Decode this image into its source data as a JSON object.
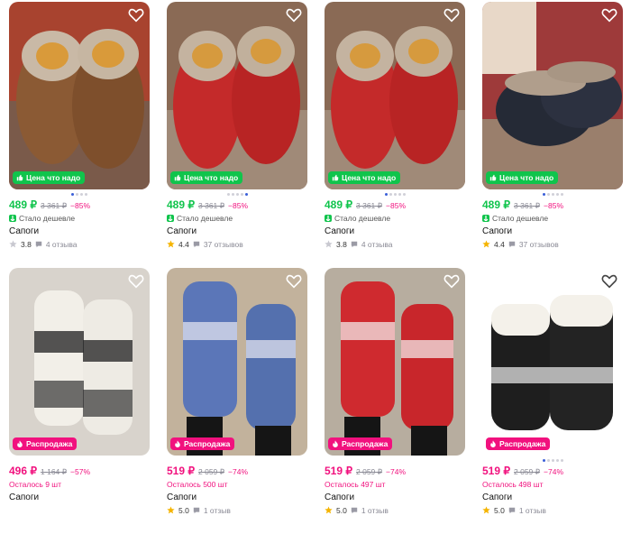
{
  "products": [
    {
      "price": "489 ₽",
      "old_price": "3 361 ₽",
      "discount": "−85%",
      "badge": "Цена что надо",
      "sub": "Стало дешевле",
      "title": "Сапоги",
      "rating": "3.8",
      "reviews": "4 отзыва",
      "rating_star": "gray",
      "color": "brown"
    },
    {
      "price": "489 ₽",
      "old_price": "3 361 ₽",
      "discount": "−85%",
      "badge": "Цена что надо",
      "sub": "Стало дешевле",
      "title": "Сапоги",
      "rating": "4.4",
      "reviews": "37 отзывов",
      "rating_star": "gold",
      "color": "red"
    },
    {
      "price": "489 ₽",
      "old_price": "3 361 ₽",
      "discount": "−85%",
      "badge": "Цена что надо",
      "sub": "Стало дешевле",
      "title": "Сапоги",
      "rating": "3.8",
      "reviews": "4 отзыва",
      "rating_star": "gray",
      "color": "red"
    },
    {
      "price": "489 ₽",
      "old_price": "3 361 ₽",
      "discount": "−85%",
      "badge": "Цена что надо",
      "sub": "Стало дешевле",
      "title": "Сапоги",
      "rating": "4.4",
      "reviews": "37 отзывов",
      "rating_star": "gold",
      "color": "black"
    },
    {
      "price": "496 ₽",
      "old_price": "1 164 ₽",
      "discount": "−57%",
      "badge": "Распродажа",
      "sub": "Осталось 9 шт",
      "title": "Сапоги",
      "rating": "",
      "reviews": "",
      "rating_star": "none",
      "color": "bw"
    },
    {
      "price": "519 ₽",
      "old_price": "2 059 ₽",
      "discount": "−74%",
      "badge": "Распродажа",
      "sub": "Осталось 500 шт",
      "title": "Сапоги",
      "rating": "5.0",
      "reviews": "1 отзыв",
      "rating_star": "gold",
      "color": "blue"
    },
    {
      "price": "519 ₽",
      "old_price": "2 059 ₽",
      "discount": "−74%",
      "badge": "Распродажа",
      "sub": "Осталось 497 шт",
      "title": "Сапоги",
      "rating": "5.0",
      "reviews": "1 отзыв",
      "rating_star": "gold",
      "color": "redknit"
    },
    {
      "price": "519 ₽",
      "old_price": "2 059 ₽",
      "discount": "−74%",
      "badge": "Распродажа",
      "sub": "Осталось 498 шт",
      "title": "Сапоги",
      "rating": "5.0",
      "reviews": "1 отзыв",
      "rating_star": "gold",
      "color": "blackknit"
    }
  ],
  "colors": {
    "accent_green": "#10c44c",
    "accent_pink": "#f1117e",
    "star_gold": "#f5b400"
  },
  "icons": {
    "favorite": "heart-icon",
    "cheaper": "thumb-up-icon",
    "sale": "flame-icon",
    "rating": "star-icon",
    "reviews": "chat-bubble-icon"
  }
}
